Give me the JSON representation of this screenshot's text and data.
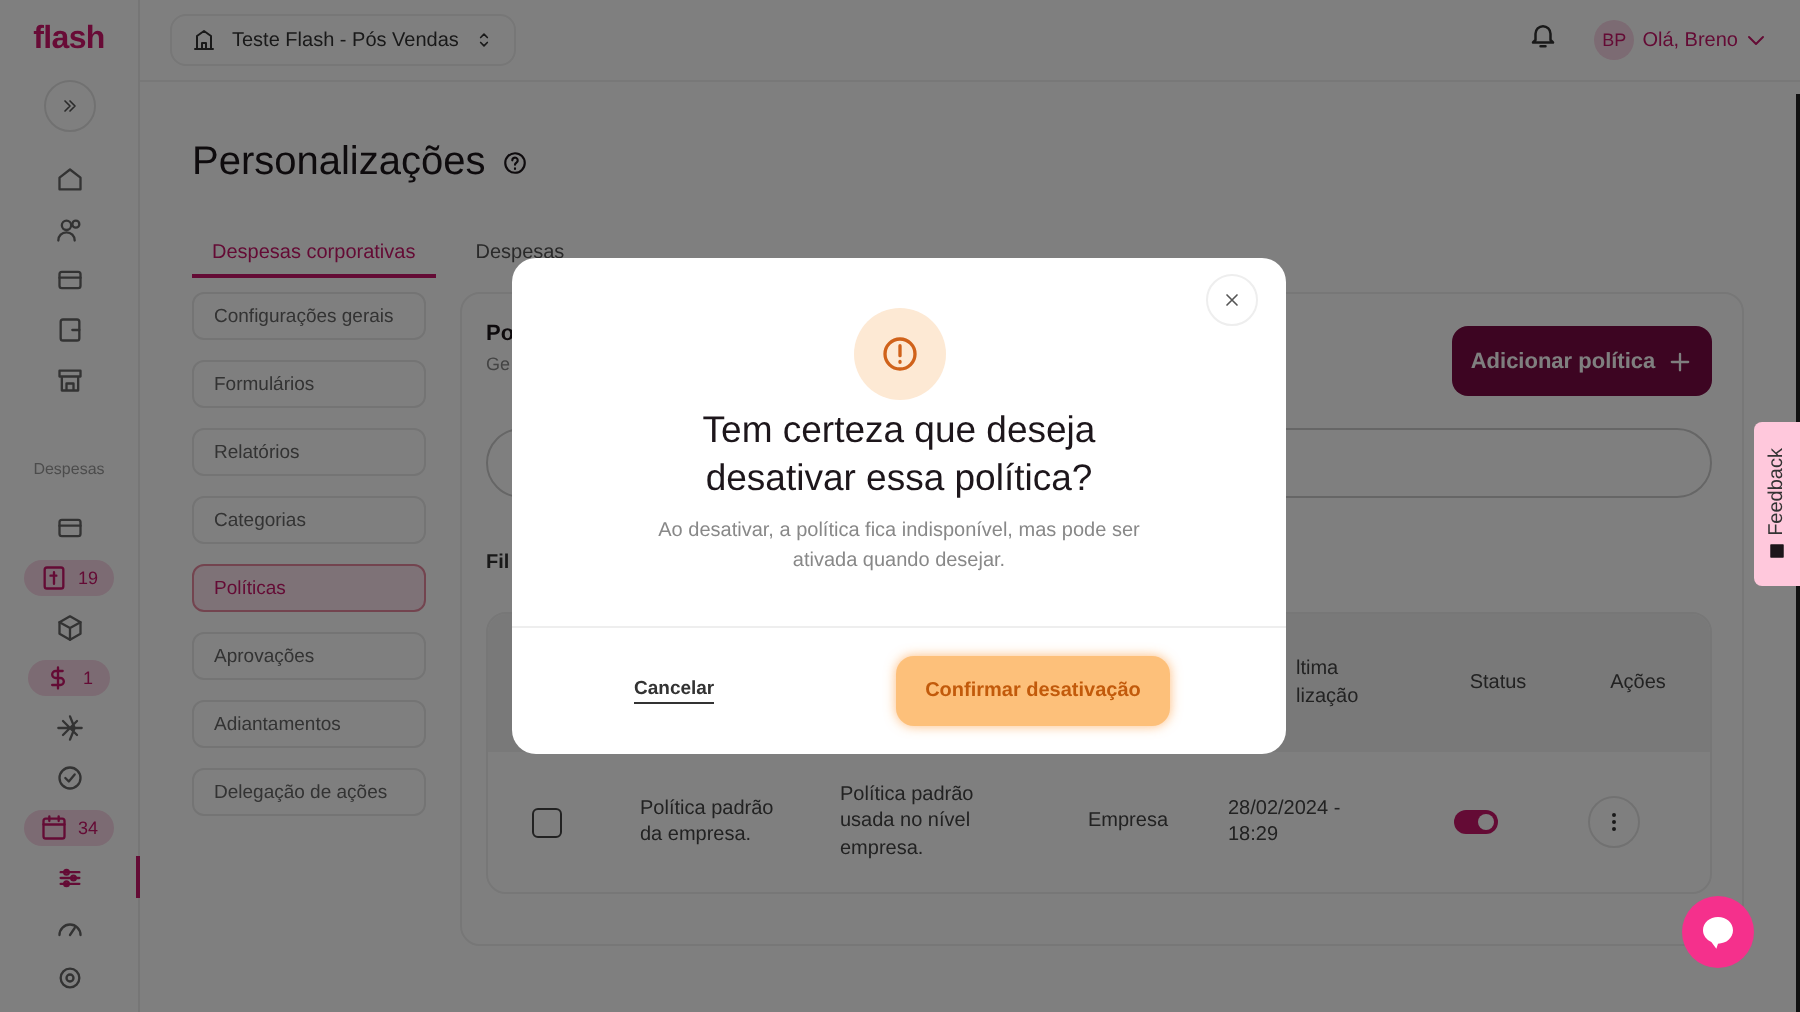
{
  "topbar": {
    "logo": "flash",
    "company": "Teste Flash - Pós Vendas",
    "avatar": "BP",
    "greeting": "Olá, Breno"
  },
  "sidebar": {
    "top_items": [
      {
        "selected": false
      },
      {
        "selected": false
      },
      {
        "selected": false
      },
      {
        "selected": false
      },
      {
        "selected": false
      }
    ],
    "section_label": "Despesas",
    "items": [
      {
        "selected": false
      },
      {
        "selected": false,
        "badge": "19"
      },
      {
        "selected": false
      },
      {
        "selected": false,
        "badge": "1"
      },
      {
        "selected": false
      },
      {
        "selected": false
      },
      {
        "selected": false,
        "badge": "34"
      },
      {
        "selected": true
      },
      {
        "selected": false
      },
      {
        "selected": false
      }
    ]
  },
  "page": {
    "title": "Personalizações",
    "tabs": [
      {
        "label": "Despesas corporativas",
        "selected": true
      },
      {
        "label": "Despesas",
        "selected": false
      }
    ],
    "menu": [
      {
        "label": "Configurações gerais",
        "selected": false
      },
      {
        "label": "Formulários",
        "selected": false
      },
      {
        "label": "Relatórios",
        "selected": false
      },
      {
        "label": "Categorias",
        "selected": false
      },
      {
        "label": "Políticas",
        "selected": true
      },
      {
        "label": "Aprovações",
        "selected": false
      },
      {
        "label": "Adiantamentos",
        "selected": false
      },
      {
        "label": "Delegação de ações",
        "selected": false
      }
    ],
    "panel": {
      "title": "Po",
      "subtitle": "Ge",
      "add_button": "Adicionar política",
      "filters_label": "Fil",
      "table": {
        "columns": [
          {
            "label": "ltima lização"
          },
          {
            "label": "Status"
          },
          {
            "label": "Ações"
          }
        ],
        "rows": [
          {
            "checked": false,
            "name": "Política padrão da empresa.",
            "description": "Política padrão usada no nível empresa.",
            "level": "Empresa",
            "updated": "28/02/2024 - 18:29",
            "on": true
          }
        ]
      }
    }
  },
  "modal": {
    "title": "Tem certeza que deseja desativar essa política?",
    "message": "Ao desativar, a política fica indisponível, mas pode ser ativada quando desejar.",
    "cancel": "Cancelar",
    "confirm": "Confirmar desativação"
  },
  "feedback": {
    "label": "Feedback"
  }
}
